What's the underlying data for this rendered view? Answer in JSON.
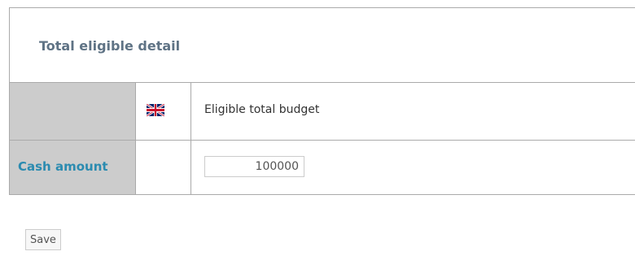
{
  "panel": {
    "title": "Total eligible detail"
  },
  "table": {
    "header_row": {
      "language_icon": "uk-flag-icon",
      "column_label": "Eligible total budget"
    },
    "rows": [
      {
        "label": "Cash amount",
        "value": "100000"
      }
    ]
  },
  "actions": {
    "save_label": "Save"
  },
  "colors": {
    "title": "#5f7385",
    "row_label": "#2b8bb0",
    "label_cell_bg": "#cccccc",
    "border": "#aaaaaa"
  }
}
